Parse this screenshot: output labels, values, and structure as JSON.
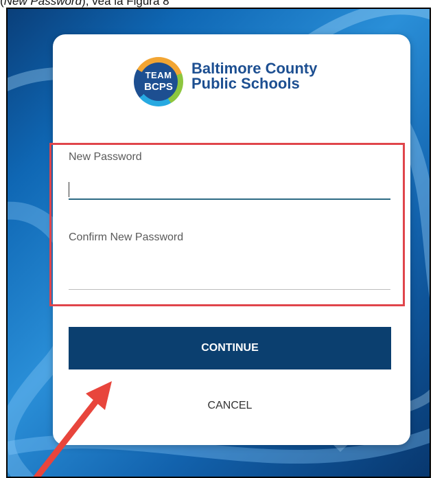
{
  "caption": {
    "prefix": "(",
    "italic": "New Password",
    "suffix": "), vea la Figura 8"
  },
  "logo": {
    "badge_top": "TEAM",
    "badge_bottom": "BCPS",
    "name_line1": "Baltimore County",
    "name_line2": "Public Schools"
  },
  "form": {
    "new_password_label": "New Password",
    "new_password_value": "",
    "confirm_password_label": "Confirm New Password",
    "confirm_password_value": ""
  },
  "buttons": {
    "continue": "CONTINUE",
    "cancel": "CANCEL"
  },
  "colors": {
    "brand_blue": "#1d4f91",
    "button_blue": "#0b3f6f",
    "highlight_red": "#e0454b",
    "arrow_red": "#e8453c"
  },
  "icons": [
    "team-bcps-logo-icon",
    "annotation-arrow-icon"
  ]
}
